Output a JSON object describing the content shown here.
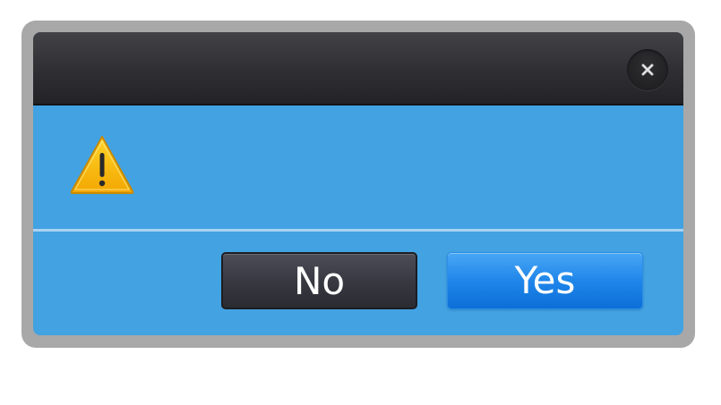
{
  "dialog": {
    "close_icon": "close-icon",
    "warning_icon": "warning-triangle-icon",
    "message": "",
    "buttons": {
      "no_label": "No",
      "yes_label": "Yes"
    }
  },
  "colors": {
    "frame": "#a8a8a8",
    "titlebar": "#2f2f33",
    "body": "#42a2e2",
    "divider": "#a9d2f1",
    "no_button": "#373740",
    "yes_button": "#1f86ea",
    "warning": "#f5b800"
  }
}
